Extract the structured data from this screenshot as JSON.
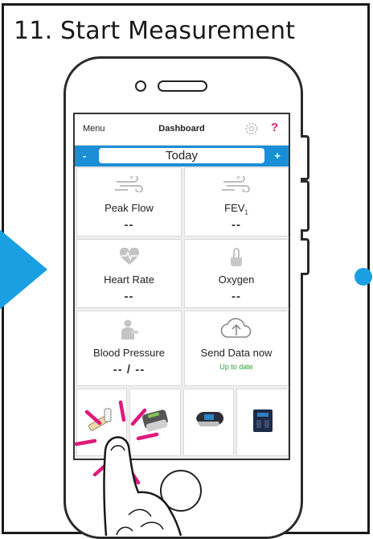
{
  "step": {
    "title": "11. Start Measurement"
  },
  "app": {
    "menu_label": "Menu",
    "title": "Dashboard",
    "help_label": "?",
    "settings_icon": "gear-icon"
  },
  "date_nav": {
    "prev_label": "-",
    "current": "Today",
    "next_label": "+"
  },
  "tiles": {
    "peak_flow": {
      "label": "Peak Flow",
      "value": "--",
      "icon": "wind-icon"
    },
    "fev1": {
      "label": "FEV",
      "subscript": "1",
      "value": "--",
      "icon": "wind-icon"
    },
    "heart_rate": {
      "label": "Heart Rate",
      "value": "--",
      "icon": "heart-icon"
    },
    "oxygen": {
      "label": "Oxygen",
      "value": "--",
      "icon": "finger-icon"
    },
    "blood_pressure": {
      "label": "Blood Pressure",
      "value": "-- / --",
      "icon": "person-icon"
    },
    "send_data": {
      "label": "Send Data now",
      "status": "Up to date",
      "icon": "cloud-upload-icon"
    }
  },
  "devices": [
    {
      "name": "peak-flow-meter"
    },
    {
      "name": "spirometer"
    },
    {
      "name": "pulse-oximeter"
    },
    {
      "name": "scale"
    }
  ],
  "colors": {
    "accent_blue": "#1a8fd6",
    "arrow_blue": "#1aa0e2",
    "help_pink": "#d9257a",
    "tap_magenta": "#e0187c",
    "status_green": "#2aa339"
  }
}
